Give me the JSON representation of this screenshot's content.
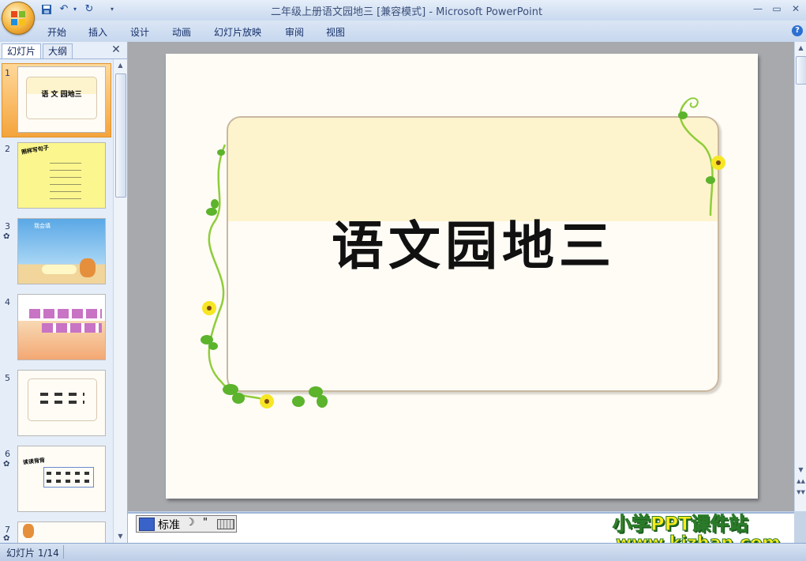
{
  "window": {
    "title": "二年级上册语文园地三 [兼容模式] - Microsoft PowerPoint",
    "controls": [
      "—",
      "▭",
      "✕"
    ]
  },
  "quick_access": {
    "save_icon": "save-icon",
    "undo_icon": "undo-icon",
    "redo_icon": "redo-icon"
  },
  "ribbon": {
    "tabs": [
      "开始",
      "插入",
      "设计",
      "动画",
      "幻灯片放映",
      "审阅",
      "视图"
    ],
    "help": "?"
  },
  "left_pane": {
    "tabs": [
      "幻灯片",
      "大纲"
    ],
    "close": "✕",
    "slides": [
      {
        "num": "1",
        "text": "语 文 园地三",
        "selected": true
      },
      {
        "num": "2",
        "text": "照样写句子"
      },
      {
        "num": "3",
        "text": "我会填"
      },
      {
        "num": "4",
        "text": ""
      },
      {
        "num": "5",
        "text": ""
      },
      {
        "num": "6",
        "text": "读读背背"
      },
      {
        "num": "7",
        "text": ""
      }
    ]
  },
  "slide": {
    "title": "语文园地三"
  },
  "ime": {
    "mode": "标准"
  },
  "watermark": {
    "line1": "小学PPT课件站",
    "line2": "www.kjzhan.com"
  },
  "status": {
    "text": "幻灯片 1/14"
  },
  "colors": {
    "accent": "#f4a43c",
    "ribbon": "#c6d7ee",
    "slide_bg": "#fffcf6",
    "card_band": "#fdf4cd"
  }
}
